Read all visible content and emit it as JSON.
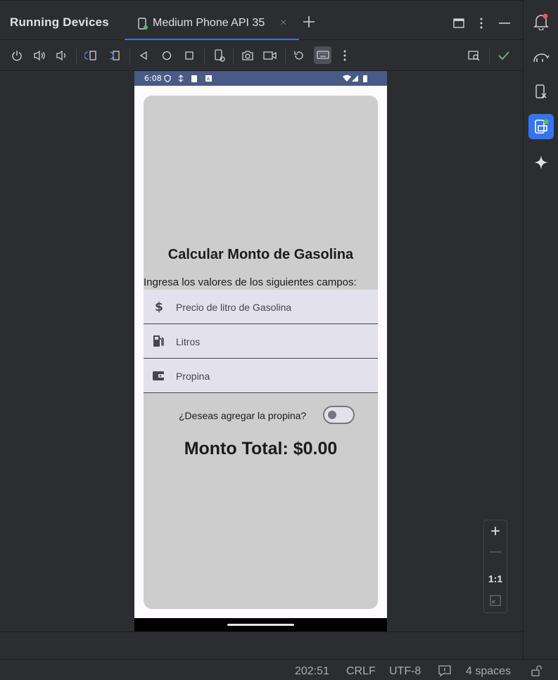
{
  "panel": {
    "title": "Running Devices"
  },
  "tab": {
    "label": "Medium Phone API 35",
    "close": "×"
  },
  "add_tab": "+",
  "phone": {
    "status_time": "6:08",
    "app": {
      "title": "Calcular Monto de Gasolina",
      "subtitle": "Ingresa los valores de los siguientes campos:",
      "fields": [
        {
          "label": "Precio de litro de Gasolina",
          "icon": "dollar-icon"
        },
        {
          "label": "Litros",
          "icon": "gas-station-icon"
        },
        {
          "label": "Propina",
          "icon": "wallet-icon"
        }
      ],
      "switch_label": "¿Deseas agregar la propina?",
      "switch_on": false,
      "total": "Monto Total: $0.00"
    }
  },
  "zoom": {
    "plus": "+",
    "minus": "—",
    "actual": "1:1"
  },
  "statusbar": {
    "position": "202:51",
    "line_ending": "CRLF",
    "encoding": "UTF-8",
    "indent": "4 spaces"
  },
  "colors": {
    "accent": "#3574f0",
    "success": "#5fb865",
    "notification": "#e55765"
  }
}
